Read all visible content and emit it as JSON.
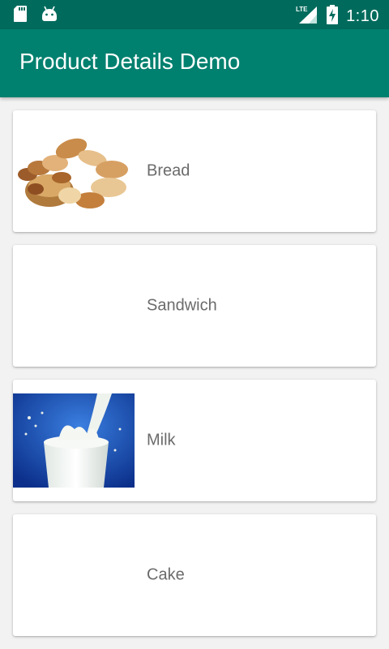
{
  "status_bar": {
    "time": "1:10",
    "network": "LTE",
    "icons": [
      "sd-card-icon",
      "android-icon",
      "lte-signal-icon",
      "battery-charging-icon"
    ]
  },
  "app_bar": {
    "title": "Product Details Demo"
  },
  "colors": {
    "status_bar": "#006b5d",
    "app_bar": "#00806f",
    "background": "#f2f2f2",
    "card": "#ffffff",
    "label": "#6b6b6b"
  },
  "products": [
    {
      "name": "Bread",
      "image": "bread-image"
    },
    {
      "name": "Sandwich",
      "image": ""
    },
    {
      "name": "Milk",
      "image": "milk-image"
    },
    {
      "name": "Cake",
      "image": ""
    }
  ]
}
